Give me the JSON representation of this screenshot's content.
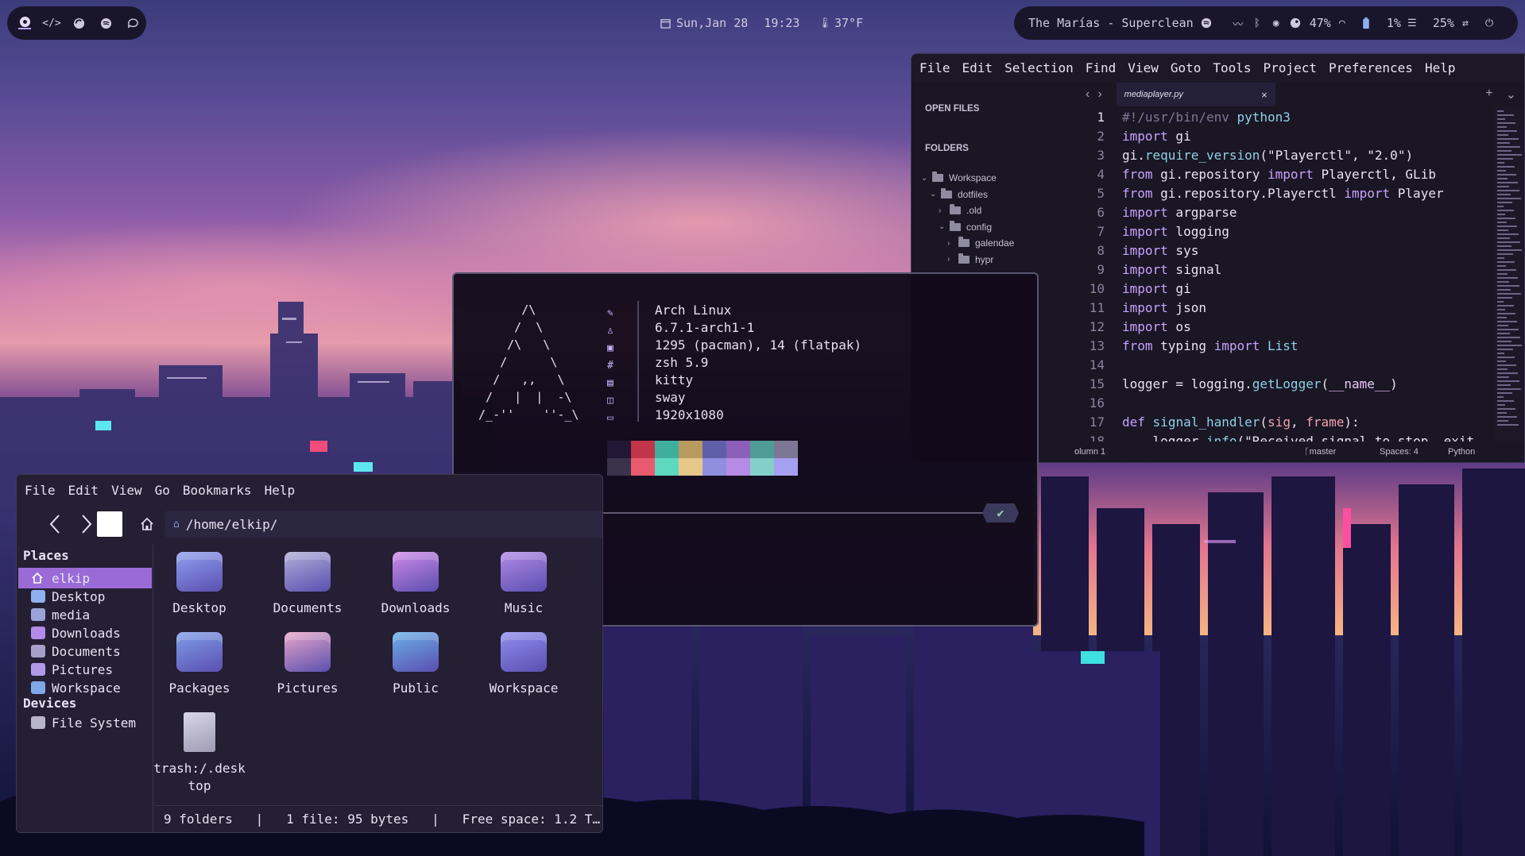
{
  "topbar": {
    "workspace_icons": [
      "arch-icon",
      "code-icon",
      "firefox-icon",
      "spotify-icon",
      "chat-icon"
    ],
    "date": "Sun,Jan 28",
    "time": "19:23",
    "weather": "37°F",
    "now_playing": "The Marías - Superclean",
    "cpu": "47%",
    "memory": "1%",
    "disk": "25%"
  },
  "sublime": {
    "menu": [
      "File",
      "Edit",
      "Selection",
      "Find",
      "View",
      "Goto",
      "Tools",
      "Project",
      "Preferences",
      "Help"
    ],
    "open_files_label": "OPEN FILES",
    "folders_label": "FOLDERS",
    "tree": [
      {
        "label": "Workspace",
        "level": 0,
        "open": true
      },
      {
        "label": "dotfiles",
        "level": 1,
        "open": true
      },
      {
        "label": ".old",
        "level": 2,
        "open": false
      },
      {
        "label": "config",
        "level": 2,
        "open": true
      },
      {
        "label": "galendae",
        "level": 3,
        "open": false
      },
      {
        "label": "hypr",
        "level": 3,
        "open": false
      }
    ],
    "tab": "mediaplayer.py",
    "status": {
      "position": "olumn 1",
      "branch": "master",
      "spaces": "Spaces: 4",
      "syntax": "Python"
    },
    "code": [
      [
        [
          "cm",
          "#!/usr/bin/env "
        ],
        [
          "fn",
          "python3"
        ]
      ],
      [
        [
          "kw",
          "import"
        ],
        [
          "pl",
          " gi"
        ]
      ],
      [
        [
          "pl",
          "gi."
        ],
        [
          "fn",
          "require_version"
        ],
        [
          "pl",
          "("
        ],
        [
          "str",
          "\"Playerctl\""
        ],
        [
          "pl",
          ", "
        ],
        [
          "str",
          "\"2.0\""
        ],
        [
          "pl",
          ")"
        ]
      ],
      [
        [
          "kw",
          "from"
        ],
        [
          "pl",
          " gi.repository "
        ],
        [
          "kw",
          "import"
        ],
        [
          "pl",
          " Playerctl, GLib"
        ]
      ],
      [
        [
          "kw",
          "from"
        ],
        [
          "pl",
          " gi.repository.Playerctl "
        ],
        [
          "kw",
          "import"
        ],
        [
          "pl",
          " Player"
        ]
      ],
      [
        [
          "kw",
          "import"
        ],
        [
          "pl",
          " argparse"
        ]
      ],
      [
        [
          "kw",
          "import"
        ],
        [
          "pl",
          " logging"
        ]
      ],
      [
        [
          "kw",
          "import"
        ],
        [
          "pl",
          " sys"
        ]
      ],
      [
        [
          "kw",
          "import"
        ],
        [
          "pl",
          " signal"
        ]
      ],
      [
        [
          "kw",
          "import"
        ],
        [
          "pl",
          " gi"
        ]
      ],
      [
        [
          "kw",
          "import"
        ],
        [
          "pl",
          " json"
        ]
      ],
      [
        [
          "kw",
          "import"
        ],
        [
          "pl",
          " os"
        ]
      ],
      [
        [
          "kw",
          "from"
        ],
        [
          "pl",
          " typing "
        ],
        [
          "kw",
          "import"
        ],
        [
          "fn",
          " List"
        ]
      ],
      [],
      [
        [
          "pl",
          "logger = logging."
        ],
        [
          "fn",
          "getLogger"
        ],
        [
          "pl",
          "("
        ],
        [
          "dunder",
          "__name__"
        ],
        [
          "pl",
          ")"
        ]
      ],
      [],
      [
        [
          "kw",
          "def"
        ],
        [
          "pl",
          " "
        ],
        [
          "fn",
          "signal_handler"
        ],
        [
          "pl",
          "("
        ],
        [
          "param",
          "sig"
        ],
        [
          "pl",
          ", "
        ],
        [
          "param",
          "frame"
        ],
        [
          "pl",
          "):"
        ]
      ],
      [
        [
          "pl",
          "    logger."
        ],
        [
          "fn",
          "info"
        ],
        [
          "pl",
          "("
        ],
        [
          "str",
          "\"Received signal to stop, exit"
        ]
      ]
    ]
  },
  "terminal": {
    "ascii_art": "       /\\\n      /  \\\n     /\\   \\\n    /      \\\n   /   ,,   \\\n  /   |  |  -\\\n /_-''    ''-_\\",
    "fetch_icons": [
      "brush-icon",
      "linux-icon",
      "package-icon",
      "hash-icon",
      "terminal-icon",
      "window-icon",
      "monitor-icon"
    ],
    "fetch_icon_glyphs": [
      "✎",
      "♙",
      "▣",
      "#",
      "▤",
      "◫",
      "▭"
    ],
    "fetch": [
      "Arch Linux",
      "6.7.1-arch1-1",
      "1295 (pacman), 14 (flatpak)",
      "zsh 5.9",
      "kitty",
      "sway",
      "1920x1080"
    ],
    "palette_top": [
      "#221735",
      "#c0354a",
      "#3fae9c",
      "#b79a5e",
      "#5f5ea8",
      "#8c5fb8",
      "#4f9c94",
      "#7b7794"
    ],
    "palette_bottom": [
      "#3b324c",
      "#e85a6e",
      "#5fd8c0",
      "#e5c888",
      "#8f8fe0",
      "#b78ae6",
      "#84d0c8",
      "#a5a0f0"
    ],
    "prompt_dir": "~",
    "prompt_ok": "✔"
  },
  "files": {
    "menu": [
      "File",
      "Edit",
      "View",
      "Go",
      "Bookmarks",
      "Help"
    ],
    "path": "/home/elkip/",
    "places_label": "Places",
    "places": [
      {
        "label": "elkip",
        "selected": true,
        "color": "#ffffff"
      },
      {
        "label": "Desktop",
        "selected": false,
        "color": "#8fb0f0"
      },
      {
        "label": "media",
        "selected": false,
        "color": "#9aa3d8"
      },
      {
        "label": "Downloads",
        "selected": false,
        "color": "#b38ae8"
      },
      {
        "label": "Documents",
        "selected": false,
        "color": "#a6a0c8"
      },
      {
        "label": "Pictures",
        "selected": false,
        "color": "#b09ae8"
      },
      {
        "label": "Workspace",
        "selected": false,
        "color": "#7fa8e8"
      }
    ],
    "devices_label": "Devices",
    "devices": [
      {
        "label": "File System"
      }
    ],
    "items": [
      {
        "label": "Desktop",
        "icon": "desktop-folder-icon",
        "color": "#8fa0f0"
      },
      {
        "label": "Documents",
        "icon": "documents-folder-icon",
        "color": "#b3aed8"
      },
      {
        "label": "Downloads",
        "icon": "downloads-folder-icon",
        "color": "#d08ae8"
      },
      {
        "label": "Music",
        "icon": "music-folder-icon",
        "color": "#b28ae8"
      },
      {
        "label": "Packages",
        "icon": "packages-folder-icon",
        "color": "#7f9ee8"
      },
      {
        "label": "Pictures",
        "icon": "pictures-folder-icon",
        "color": "#e8a6c8"
      },
      {
        "label": "Public",
        "icon": "public-folder-icon",
        "color": "#6ab0e8"
      },
      {
        "label": "Workspace",
        "icon": "workspace-folder-icon",
        "color": "#8f8ef0"
      },
      {
        "label": "trash:/.desk\ntop",
        "icon": "desktop-file-icon",
        "color": "#c8c6d8"
      }
    ],
    "status": "9 folders   |   1 file: 95 bytes   |   Free space: 1.2 T…"
  }
}
